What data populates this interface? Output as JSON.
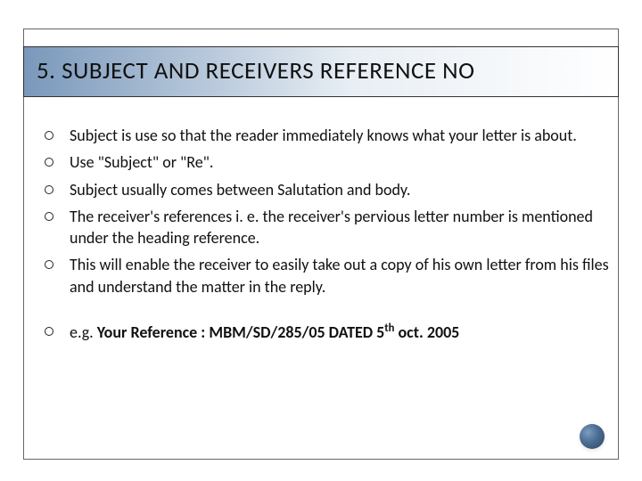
{
  "title": "5.  SUBJECT AND RECEIVERS REFERENCE NO",
  "bullets": [
    "Subject is use so that the reader immediately knows what your letter is about.",
    " Use \"Subject\" or \"Re\".",
    " Subject usually comes between Salutation and body.",
    "The receiver's references i. e. the receiver's pervious letter number is mentioned under the heading reference.",
    " This will enable the receiver to easily take out a copy of his own letter from his files and understand the matter in the reply."
  ],
  "example": {
    "prefix": "e.g.    ",
    "bold": "Your Reference : MBM/SD/285/05 DATED 5",
    "sup": "th",
    "rest": " oct. 2005"
  }
}
